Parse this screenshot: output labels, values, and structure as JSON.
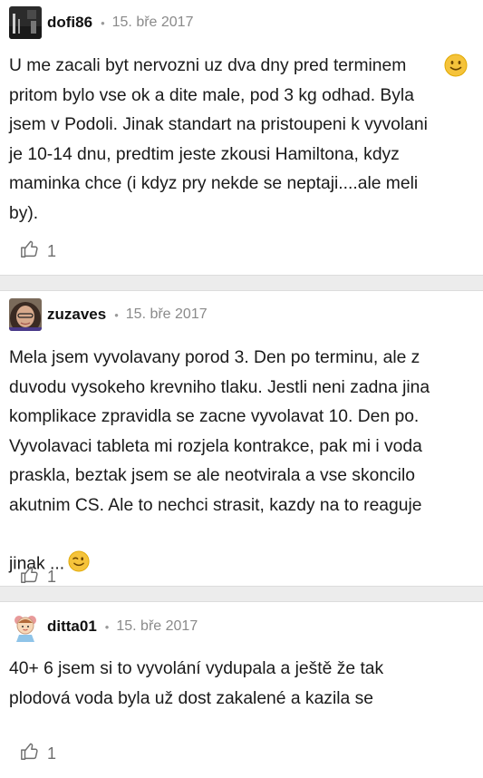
{
  "comments": [
    {
      "username": "dofi86",
      "date": "15. bře 2017",
      "text": "U me zacali byt nervozni uz dva dny pred terminem\npritom bylo vse ok a dite male, pod 3 kg odhad. Byla\njsem v Podoli. Jinak standart na pristoupeni k vyvolani\nje 10-14 dnu, predtim jeste zkousi Hamiltona, kdyz\nmaminka chce (i kdyz pry nekde se neptaji....ale meli\nby).",
      "emoji": "slightly-smiling-face-icon",
      "likes": "1"
    },
    {
      "username": "zuzaves",
      "date": "15. bře 2017",
      "text": "Mela jsem vyvolavany porod 3. Den po terminu, ale z\nduvodu vysokeho krevniho tlaku. Jestli neni zadna jina\nkomplikace zpravidla se zacne vyvolavat 10. Den po.\nVyvolavaci tableta mi rozjela kontrakce, pak mi i voda\npraskla, beztak jsem se ale neotvirala a vse skoncilo\nakutnim CS. Ale to nechci strasit, kazdy na to reaguje\njinak ...",
      "emoji": "winking-face-icon",
      "likes": "1"
    },
    {
      "username": "ditta01",
      "date": "15. bře 2017",
      "text": "40+ 6 jsem si to vyvolání vydupala a ještě že tak\nplodová voda byla už dost zakalené a kazila se",
      "likes": "1"
    }
  ],
  "colors": {
    "separator": "#ececec",
    "meta": "#8a8a8a",
    "emoji": "#f5c33b"
  }
}
